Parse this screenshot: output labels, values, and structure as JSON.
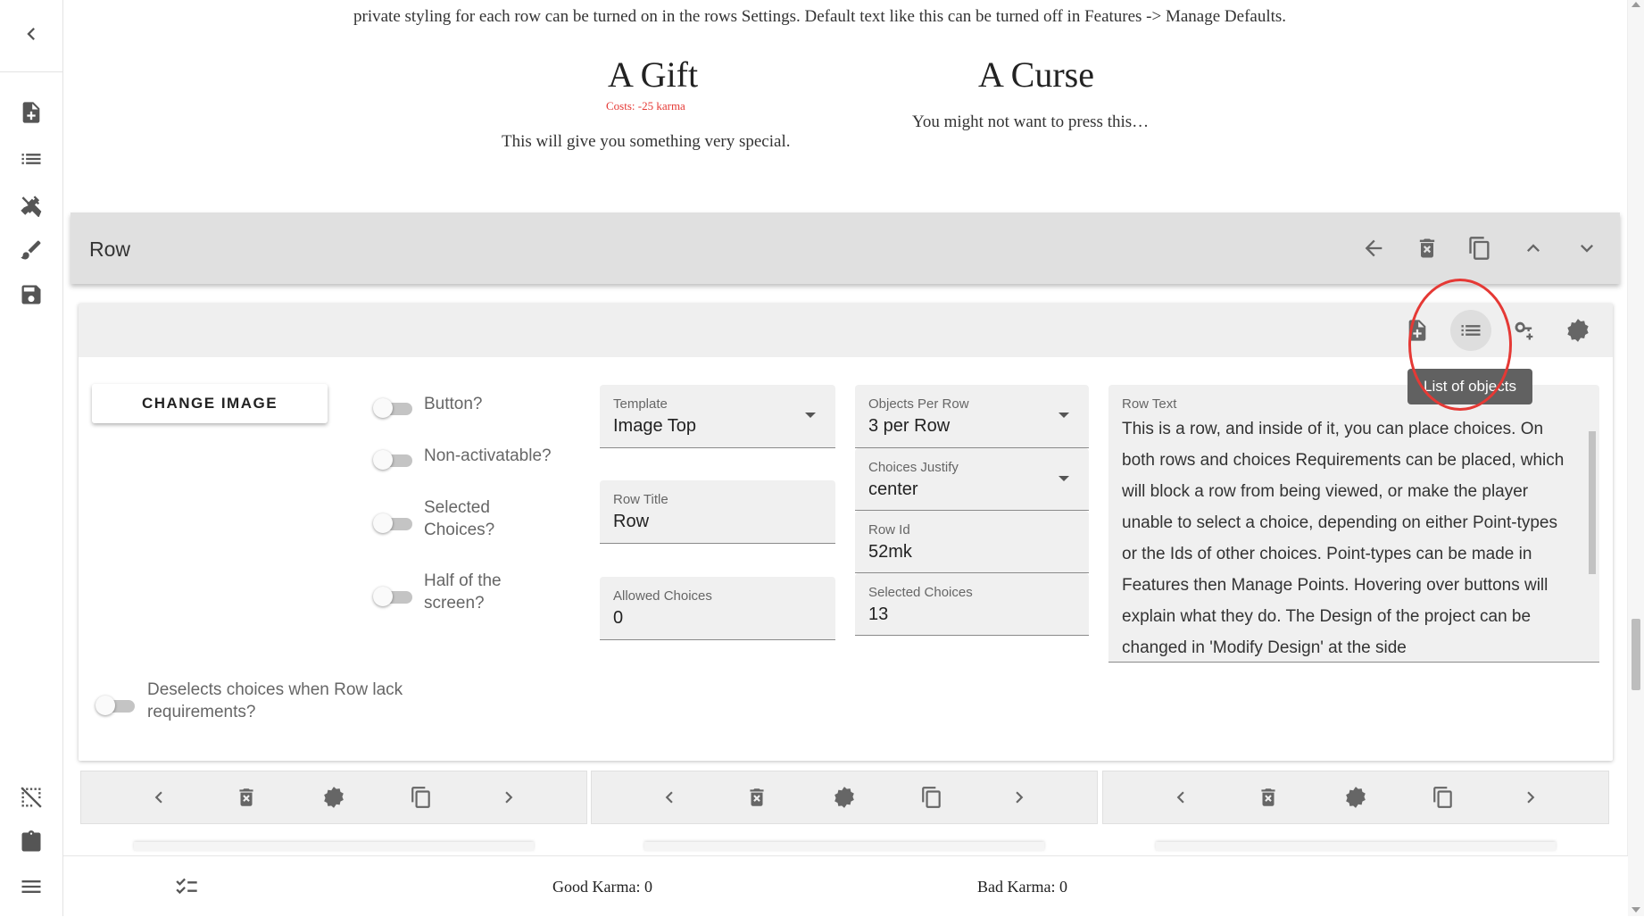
{
  "intro": {
    "text": "private styling for each row can be turned on in the rows Settings. Default text like this can be turned off in Features -> Manage Defaults."
  },
  "choices": [
    {
      "title": "A Gift",
      "cost": "Costs: -25  karma",
      "description": "This will give you something very special."
    },
    {
      "title": "A Curse",
      "cost": "",
      "description": "You might not want to press this…"
    }
  ],
  "row": {
    "header_title": "Row",
    "tooltip": "List of objects",
    "change_image_label": "CHANGE IMAGE",
    "toggles": {
      "button": "Button?",
      "non_activatable": "Non-activatable?",
      "selected_choices": "Selected Choices?",
      "half_screen": "Half of the screen?",
      "deselects": "Deselects choices when Row lack requirements?"
    },
    "fields": {
      "template": {
        "label": "Template",
        "value": "Image Top"
      },
      "row_title": {
        "label": "Row Title",
        "value": "Row"
      },
      "allowed_choices": {
        "label": "Allowed Choices",
        "value": "0"
      },
      "objects_per_row": {
        "label": "Objects Per Row",
        "value": "3 per Row"
      },
      "choices_justify": {
        "label": "Choices Justify",
        "value": "center"
      },
      "row_id": {
        "label": "Row Id",
        "value": "52mk"
      },
      "selected_choices": {
        "label": "Selected Choices",
        "value": "13"
      },
      "row_text": {
        "label": "Row Text",
        "value": "This is a row, and inside of it, you can place choices. On both rows and choices Requirements can be placed, which will block a row from being viewed, or make the player unable to select a choice, depending on either Point-types or the Ids of other choices. Point-types can be made in Features then Manage Points. Hovering over buttons will explain what they do. The Design of the project can be changed in 'Modify Design' at the side"
      }
    }
  },
  "bottom_bar": {
    "good_karma": "Good Karma: 0",
    "bad_karma": "Bad Karma: 0"
  },
  "colors": {
    "accent_red": "#e53935",
    "toolbar_gray": "#efefef",
    "header_gray": "#e0e0e0"
  },
  "icons": {
    "sidebar": [
      "chevron-left-icon",
      "add-file-icon",
      "list-icon",
      "tools-icon",
      "brush-icon",
      "save-icon",
      "no-selection-icon",
      "clipboard-icon",
      "menu-icon"
    ],
    "row_header": [
      "arrow-left-icon",
      "delete-icon",
      "copy-icon",
      "chevron-up-icon",
      "chevron-down-icon"
    ],
    "row_toolbar": [
      "add-file-icon",
      "list-icon",
      "add-key-icon",
      "settings-icon"
    ],
    "card_toolbar": [
      "chevron-left-icon",
      "delete-icon",
      "settings-icon",
      "copy-icon",
      "chevron-right-icon"
    ],
    "bottom_bar": [
      "checklist-icon"
    ]
  }
}
